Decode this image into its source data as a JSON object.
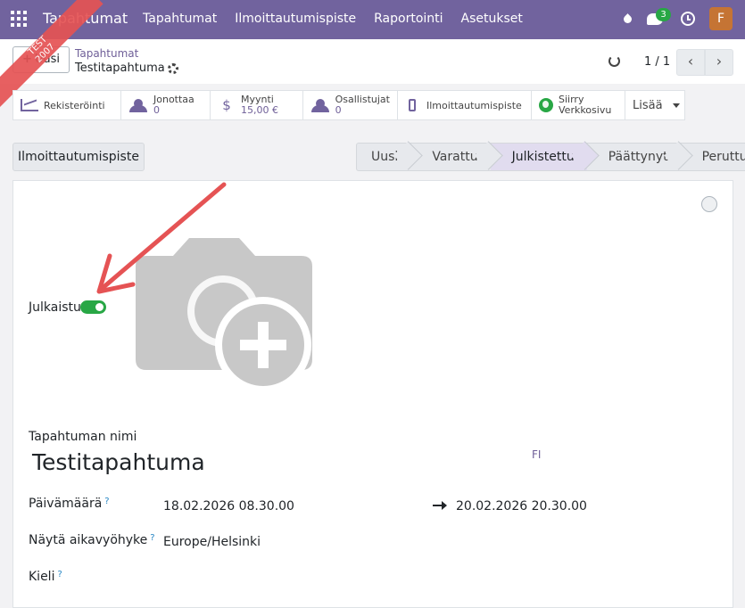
{
  "navbar": {
    "app_title": "Tapahtumat",
    "menu": [
      "Tapahtumat",
      "Ilmoittautumispiste",
      "Raportointi",
      "Asetukset"
    ],
    "chat_count": "3",
    "avatar_letter": "F",
    "color": "#71639e"
  },
  "ribbon": {
    "line1": "TEST",
    "line2": "2007"
  },
  "control": {
    "new_label": "Uusi",
    "breadcrumb_parent": "Tapahtumat",
    "breadcrumb_current": "Testitapahtuma",
    "pager": "1 / 1"
  },
  "smart_buttons": [
    {
      "label": "Rekisteröinti",
      "value": "",
      "icon": "chart-icon"
    },
    {
      "label": "Jonottaa",
      "value": "0",
      "icon": "users-icon"
    },
    {
      "label": "Myynti",
      "value": "15,00 €",
      "icon": "dollar-icon"
    },
    {
      "label": "Osallistujat",
      "value": "0",
      "icon": "users-icon"
    },
    {
      "label": "Ilmoittautumispiste",
      "value": "",
      "icon": "phone-icon"
    },
    {
      "label": "Siirry",
      "value": "Verkkosivu",
      "icon": "globe-icon"
    }
  ],
  "more_label": "Lisää",
  "registration_desk_button": "Ilmoittautumispiste",
  "stages": [
    "Uusi",
    "Varattu",
    "Julkistettu",
    "Päättynyt",
    "Peruttu"
  ],
  "active_stage": "Julkistettu",
  "form": {
    "published_label": "Julkaistu",
    "published": true,
    "name_label": "Tapahtuman nimi",
    "name_value": "Testitapahtuma",
    "lang_code": "FI",
    "date_label": "Päivämäärä",
    "date_start": "18.02.2026 08.30.00",
    "date_end": "20.02.2026 20.30.00",
    "tz_label": "Näytä aikavyöhyke",
    "tz_value": "Europe/Helsinki",
    "lang_label": "Kieli",
    "help_mark": "?"
  }
}
